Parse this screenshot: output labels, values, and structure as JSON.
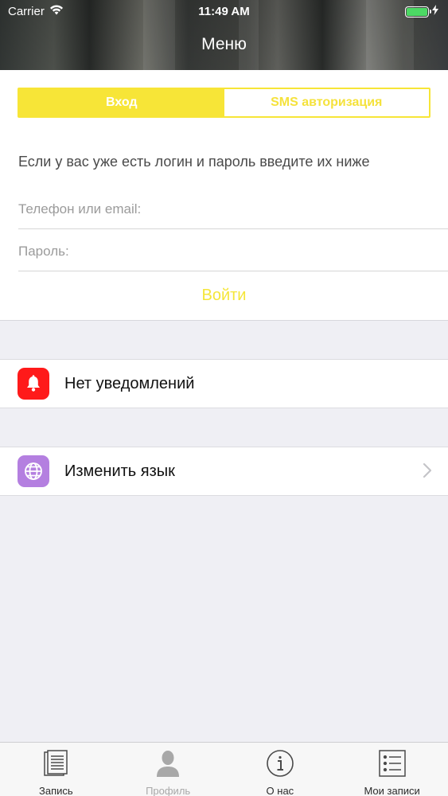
{
  "status_bar": {
    "carrier": "Carrier",
    "time": "11:49 AM"
  },
  "header": {
    "title": "Меню"
  },
  "login": {
    "tabs": [
      {
        "label": "Вход",
        "active": true
      },
      {
        "label": "SMS авторизация",
        "active": false
      }
    ],
    "hint": "Если у вас уже есть логин и пароль введите их ниже",
    "phone_placeholder": "Телефон или email:",
    "password_placeholder": "Пароль:",
    "submit_label": "Войти"
  },
  "settings": {
    "notifications_label": "Нет уведомлений",
    "language_label": "Изменить язык"
  },
  "tabbar": {
    "items": [
      {
        "label": "Запись",
        "icon": "document-icon"
      },
      {
        "label": "Профиль",
        "icon": "person-icon"
      },
      {
        "label": "О нас",
        "icon": "info-icon"
      },
      {
        "label": "Мои записи",
        "icon": "list-icon"
      }
    ]
  },
  "colors": {
    "accent_yellow": "#f7e537",
    "notification_red": "#ff1a1a",
    "language_purple": "#b47fe0",
    "battery_green": "#4cd964"
  }
}
